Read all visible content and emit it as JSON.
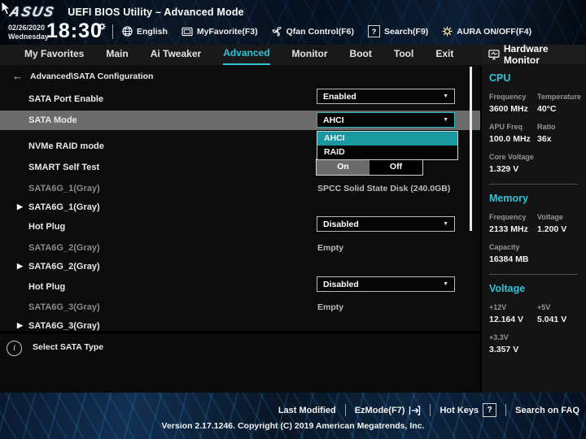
{
  "colors": {
    "accent_cyan": "#2fc4d8",
    "popup_teal": "#1a98a0",
    "row_highlight": "#6b6b6b",
    "disabled_gray": "#8a8a8a"
  },
  "header": {
    "logo": "ASUS",
    "title": "UEFI BIOS Utility – Advanced Mode",
    "date": "02/26/2020",
    "weekday": "Wednesday",
    "time": "18:30",
    "toolbar": [
      {
        "icon": "globe-icon",
        "label": "English"
      },
      {
        "icon": "myfavorite-icon",
        "label": "MyFavorite(F3)"
      },
      {
        "icon": "qfan-icon",
        "label": "Qfan Control(F6)"
      },
      {
        "icon": "search-icon",
        "label": "Search(F9)",
        "badge": "?"
      },
      {
        "icon": "aura-icon",
        "label": "AURA ON/OFF(F4)"
      }
    ]
  },
  "tabs": {
    "active": "Advanced",
    "items": [
      {
        "label": "My Favorites"
      },
      {
        "label": "Main"
      },
      {
        "label": "Ai Tweaker"
      },
      {
        "label": "Advanced"
      },
      {
        "label": "Monitor"
      },
      {
        "label": "Boot"
      },
      {
        "label": "Tool"
      },
      {
        "label": "Exit"
      }
    ]
  },
  "breadcrumb": {
    "back": "←",
    "path": "Advanced\\SATA Configuration"
  },
  "settings": {
    "rows": [
      {
        "label": "SATA Port Enable",
        "value": "Enabled",
        "type": "dropdown"
      },
      {
        "label": "SATA Mode",
        "value": "AHCI",
        "type": "dropdown-open"
      },
      {
        "label": "NVMe RAID mode",
        "type": "dropdown-hidden"
      },
      {
        "label": "SMART Self Test",
        "value": "On",
        "type": "toggle",
        "options": [
          "On",
          "Off"
        ]
      },
      {
        "label": "SATA6G_1(Gray)",
        "value": "SPCC Solid State Disk (240.0GB)",
        "type": "info"
      },
      {
        "label": "SATA6G_1(Gray)",
        "type": "link"
      },
      {
        "label": "Hot Plug",
        "value": "Disabled",
        "type": "dropdown"
      },
      {
        "label": "SATA6G_2(Gray)",
        "value": "Empty",
        "type": "info"
      },
      {
        "label": "SATA6G_2(Gray)",
        "type": "link"
      },
      {
        "label": "Hot Plug",
        "value": "Disabled",
        "type": "dropdown"
      },
      {
        "label": "SATA6G_3(Gray)",
        "value": "Empty",
        "type": "info"
      },
      {
        "label": "SATA6G_3(Gray)",
        "type": "link"
      }
    ],
    "popup": {
      "options": [
        "AHCI",
        "RAID"
      ],
      "selected": "AHCI"
    },
    "help_text": "Select SATA Type"
  },
  "hw": {
    "title": "Hardware Monitor",
    "cpu": {
      "title": "CPU",
      "metrics": [
        {
          "label": "Frequency",
          "value": "3600 MHz"
        },
        {
          "label": "Temperature",
          "value": "40°C"
        },
        {
          "label": "APU Freq",
          "value": "100.0 MHz"
        },
        {
          "label": "Ratio",
          "value": "36x"
        },
        {
          "label": "Core Voltage",
          "value": "1.329 V"
        }
      ]
    },
    "memory": {
      "title": "Memory",
      "metrics": [
        {
          "label": "Frequency",
          "value": "2133 MHz"
        },
        {
          "label": "Voltage",
          "value": "1.200 V"
        },
        {
          "label": "Capacity",
          "value": "16384 MB"
        }
      ]
    },
    "voltage": {
      "title": "Voltage",
      "metrics": [
        {
          "label": "+12V",
          "value": "12.164 V"
        },
        {
          "label": "+5V",
          "value": "5.041 V"
        },
        {
          "label": "+3.3V",
          "value": "3.357 V"
        }
      ]
    }
  },
  "footer": {
    "last_modified": "Last Modified",
    "ezmode": "EzMode(F7)",
    "hot_keys": "Hot Keys",
    "hotkeys_badge": "?",
    "search_faq": "Search on FAQ",
    "version": "Version 2.17.1246. Copyright (C) 2019 American Megatrends, Inc."
  }
}
